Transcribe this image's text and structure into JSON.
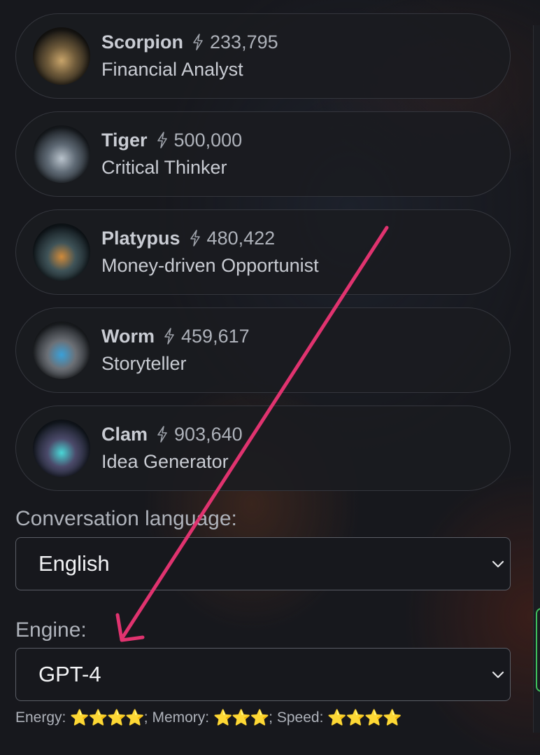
{
  "agents": [
    {
      "name": "Scorpion",
      "energy": "233,795",
      "role": "Financial Analyst",
      "avatar_colors": [
        "#1a1815",
        "#6e5a3a",
        "#c8a46a"
      ]
    },
    {
      "name": "Tiger",
      "energy": "500,000",
      "role": "Critical Thinker",
      "avatar_colors": [
        "#1b1f24",
        "#5f6a75",
        "#b9c3cc"
      ]
    },
    {
      "name": "Platypus",
      "energy": "480,422",
      "role": "Money-driven Opportunist",
      "avatar_colors": [
        "#12191e",
        "#3f5358",
        "#d08a3a"
      ]
    },
    {
      "name": "Worm",
      "energy": "459,617",
      "role": "Storyteller",
      "avatar_colors": [
        "#1f2226",
        "#6c7076",
        "#3aa0d8"
      ]
    },
    {
      "name": "Clam",
      "energy": "903,640",
      "role": "Idea Generator",
      "avatar_colors": [
        "#141a22",
        "#4b4a6a",
        "#4ad6d6"
      ]
    }
  ],
  "language": {
    "label": "Conversation language:",
    "value": "English"
  },
  "engine": {
    "label": "Engine:",
    "value": "GPT-4"
  },
  "stats": {
    "energy_label": "Energy: ",
    "energy_stars": "⭐⭐⭐⭐",
    "sep1": "; Memory: ",
    "memory_stars": "⭐⭐⭐",
    "sep2": "; Speed: ",
    "speed_stars": "⭐⭐⭐⭐"
  },
  "colors": {
    "background": "#17181d",
    "card_border": "#34363d",
    "annotation_arrow": "#e0336f",
    "star": "#f6c33b"
  },
  "icons": {
    "energy": "lightning-bolt-icon",
    "select": "chevron-down-icon"
  }
}
